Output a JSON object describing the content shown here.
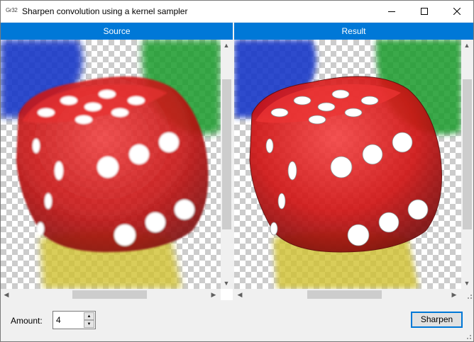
{
  "window": {
    "app_icon_text": "Gr32",
    "title": "Sharpen convolution using a kernel sampler"
  },
  "source_panel": {
    "header": "Source"
  },
  "result_panel": {
    "header": "Result"
  },
  "controls": {
    "amount_label": "Amount:",
    "amount_value": "4",
    "sharpen_label": "Sharpen"
  },
  "icons": {
    "minimize": "minimize-icon",
    "maximize": "maximize-icon",
    "close": "close-icon",
    "scroll_up": "chevron-up-icon",
    "scroll_down": "chevron-down-icon",
    "scroll_left": "chevron-left-icon",
    "scroll_right": "chevron-right-icon"
  },
  "colors": {
    "header_bg": "#0078d7",
    "die_red": "#d81818",
    "die_blue": "#1838c8",
    "die_green": "#1a9a2a",
    "die_yellow": "#cfc030"
  }
}
